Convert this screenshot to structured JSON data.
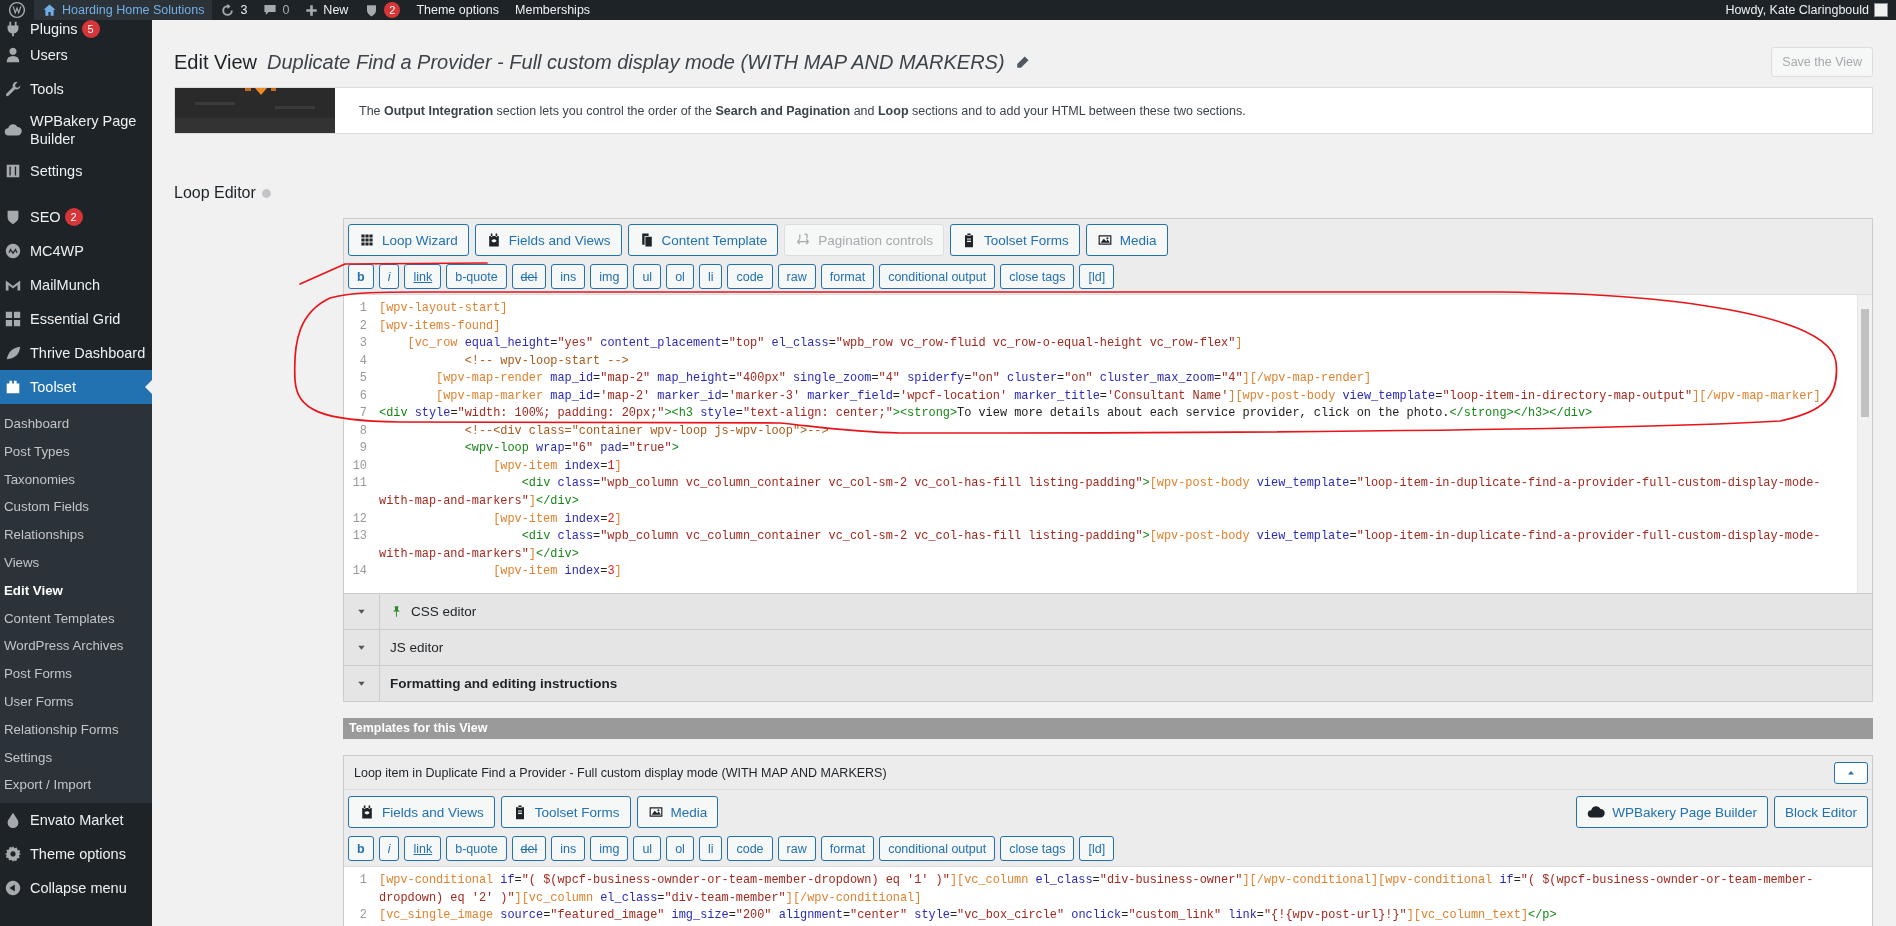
{
  "admin_bar": {
    "site_name": "Hoarding Home Solutions",
    "updates": "3",
    "comments": "0",
    "new_label": "New",
    "seo_badge": "2",
    "links": [
      "Theme options",
      "Memberships"
    ],
    "greeting": "Howdy, Kate Claringbould"
  },
  "sidebar": {
    "items": [
      {
        "label": "Plugins",
        "badge": "5",
        "selected": false
      },
      {
        "label": "Users",
        "selected": false
      },
      {
        "label": "Tools",
        "selected": false
      },
      {
        "label": "WPBakery Page Builder",
        "selected": false
      },
      {
        "label": "Settings",
        "selected": false
      },
      {
        "label": "SEO",
        "badge": "2",
        "selected": false
      },
      {
        "label": "MC4WP",
        "selected": false
      },
      {
        "label": "MailMunch",
        "selected": false
      },
      {
        "label": "Essential Grid",
        "selected": false
      },
      {
        "label": "Thrive Dashboard",
        "selected": false
      },
      {
        "label": "Toolset",
        "selected": true,
        "children": [
          {
            "label": "Dashboard",
            "selected": false
          },
          {
            "label": "Post Types",
            "selected": false
          },
          {
            "label": "Taxonomies",
            "selected": false
          },
          {
            "label": "Custom Fields",
            "selected": false
          },
          {
            "label": "Relationships",
            "selected": false
          },
          {
            "label": "Views",
            "selected": false
          },
          {
            "label": "Edit View",
            "selected": true
          },
          {
            "label": "Content Templates",
            "selected": false
          },
          {
            "label": "WordPress Archives",
            "selected": false
          },
          {
            "label": "Post Forms",
            "selected": false
          },
          {
            "label": "User Forms",
            "selected": false
          },
          {
            "label": "Relationship Forms",
            "selected": false
          },
          {
            "label": "Settings",
            "selected": false
          },
          {
            "label": "Export / Import",
            "selected": false
          }
        ]
      },
      {
        "label": "Envato Market",
        "selected": false
      },
      {
        "label": "Theme options",
        "selected": false
      },
      {
        "label": "Collapse menu",
        "selected": false
      }
    ]
  },
  "header": {
    "title": "Edit View",
    "view_name": "Duplicate Find a Provider - Full custom display mode (WITH MAP AND MARKERS)",
    "save_button": {
      "label": "Save the View",
      "disabled": true
    }
  },
  "notice": {
    "text": "The **Output Integration** section lets you control the order of the **Search and Pagination** and **Loop** sections and to add your HTML between these two sections."
  },
  "loop_editor": {
    "title": "Loop Editor",
    "tool_buttons": [
      {
        "label": "Loop Wizard",
        "disabled": false
      },
      {
        "label": "Fields and Views",
        "disabled": false
      },
      {
        "label": "Content Template",
        "disabled": false
      },
      {
        "label": "Pagination controls",
        "disabled": true
      },
      {
        "label": "Toolset Forms",
        "disabled": false
      },
      {
        "label": "Media",
        "disabled": false
      }
    ],
    "format_buttons": [
      {
        "label": "b",
        "kind": "bold"
      },
      {
        "label": "i",
        "kind": "italic"
      },
      {
        "label": "link",
        "kind": "underline"
      },
      {
        "label": "b-quote",
        "kind": "plain"
      },
      {
        "label": "del",
        "kind": "strike"
      },
      {
        "label": "ins",
        "kind": "plain"
      },
      {
        "label": "img",
        "kind": "plain"
      },
      {
        "label": "ul",
        "kind": "plain"
      },
      {
        "label": "ol",
        "kind": "plain"
      },
      {
        "label": "li",
        "kind": "plain"
      },
      {
        "label": "code",
        "kind": "plain"
      },
      {
        "label": "raw",
        "kind": "plain"
      },
      {
        "label": "format",
        "kind": "plain"
      },
      {
        "label": "conditional output",
        "kind": "plain"
      },
      {
        "label": "close tags",
        "kind": "plain"
      },
      {
        "label": "[ld]",
        "kind": "plain"
      }
    ],
    "code": [
      {
        "number": "1",
        "rows": [
          "[wpv-layout-start]"
        ]
      },
      {
        "number": "2",
        "rows": [
          "[wpv-items-found]"
        ]
      },
      {
        "number": "3",
        "rows": [
          "    [vc_row equal_height=\"yes\" content_placement=\"top\" el_class=\"wpb_row vc_row-fluid vc_row-o-equal-height vc_row-flex\"]"
        ]
      },
      {
        "number": "4",
        "rows": [
          "            <!-- wpv-loop-start -->"
        ]
      },
      {
        "number": "5",
        "rows": [
          "        [wpv-map-render map_id=\"map-2\" map_height=\"400px\" single_zoom=\"4\" spiderfy=\"on\" cluster=\"on\" cluster_max_zoom=\"4\"][/wpv-map-render]"
        ]
      },
      {
        "number": "6",
        "rows": [
          "        [wpv-map-marker map_id='map-2' marker_id='marker-3' marker_field='wpcf-location' marker_title='Consultant Name'][wpv-post-body view_template=\"loop-item-in-directory-map-output\"][/wpv-map-marker]"
        ]
      },
      {
        "number": "7",
        "rows": [
          "<div style=\"width: 100%; padding: 20px;\"><h3 style=\"text-align: center;\"><strong>To view more details about each service provider, click on the photo.</strong></h3></div>"
        ]
      },
      {
        "number": "8",
        "rows": [
          "            <!--<div class=\"container wpv-loop js-wpv-loop\">-->"
        ]
      },
      {
        "number": "9",
        "rows": [
          "            <wpv-loop wrap=\"6\" pad=\"true\">"
        ]
      },
      {
        "number": "10",
        "rows": [
          "                [wpv-item index=1]"
        ]
      },
      {
        "number": "11",
        "rows": [
          "                    <div class=\"wpb_column vc_column_container vc_col-sm-2 vc_col-has-fill listing-padding\">[wpv-post-body view_template=\"loop-item-in-duplicate-find-a-provider-full-custom-display-mode-",
          "with-map-and-markers\"]</div>"
        ]
      },
      {
        "number": "12",
        "rows": [
          "                [wpv-item index=2]"
        ]
      },
      {
        "number": "13",
        "rows": [
          "                    <div class=\"wpb_column vc_column_container vc_col-sm-2 vc_col-has-fill listing-padding\">[wpv-post-body view_template=\"loop-item-in-duplicate-find-a-provider-full-custom-display-mode-",
          "with-map-and-markers\"]</div>"
        ]
      },
      {
        "number": "14",
        "rows": [
          "                [wpv-item index=3]"
        ]
      }
    ]
  },
  "sections": [
    {
      "label": "CSS editor",
      "pinned": true,
      "kind": "plain"
    },
    {
      "label": "JS editor",
      "pinned": false,
      "kind": "plain"
    },
    {
      "label": "Formatting and editing instructions",
      "pinned": false,
      "kind": "heading"
    }
  ],
  "templates": {
    "heading": "Templates for this View",
    "items": [
      {
        "title": "Loop item in Duplicate Find a Provider - Full custom display mode (WITH MAP AND MARKERS)",
        "tool_buttons": [
          "Fields and Views",
          "Toolset Forms",
          "Media"
        ],
        "editor_buttons": [
          "WPBakery Page Builder",
          "Block Editor"
        ],
        "format_buttons": [
          {
            "label": "b",
            "kind": "bold"
          },
          {
            "label": "i",
            "kind": "italic"
          },
          {
            "label": "link",
            "kind": "underline"
          },
          {
            "label": "b-quote",
            "kind": "plain"
          },
          {
            "label": "del",
            "kind": "strike"
          },
          {
            "label": "ins",
            "kind": "plain"
          },
          {
            "label": "img",
            "kind": "plain"
          },
          {
            "label": "ul",
            "kind": "plain"
          },
          {
            "label": "ol",
            "kind": "plain"
          },
          {
            "label": "li",
            "kind": "plain"
          },
          {
            "label": "code",
            "kind": "plain"
          },
          {
            "label": "raw",
            "kind": "plain"
          },
          {
            "label": "format",
            "kind": "plain"
          },
          {
            "label": "conditional output",
            "kind": "plain"
          },
          {
            "label": "close tags",
            "kind": "plain"
          },
          {
            "label": "[ld]",
            "kind": "plain"
          }
        ],
        "code": [
          {
            "number": "1",
            "rows": [
              "[wpv-conditional if=\"( $(wpcf-business-ownder-or-team-member-dropdown) eq '1' )\"][vc_column el_class=\"div-business-owner\"][/wpv-conditional][wpv-conditional if=\"( $(wpcf-business-ownder-or-team-member-",
              "dropdown) eq '2' )\"][vc_column el_class=\"div-team-member\"][/wpv-conditional]"
            ]
          },
          {
            "number": "2",
            "rows": [
              "[vc_single_image source=\"featured_image\" img_size=\"200\" alignment=\"center\" style=\"vc_box_circle\" onclick=\"custom_link\" link=\"{!{wpv-post-url}!}\"][vc_column_text]</p>"
            ]
          }
        ]
      }
    ]
  }
}
